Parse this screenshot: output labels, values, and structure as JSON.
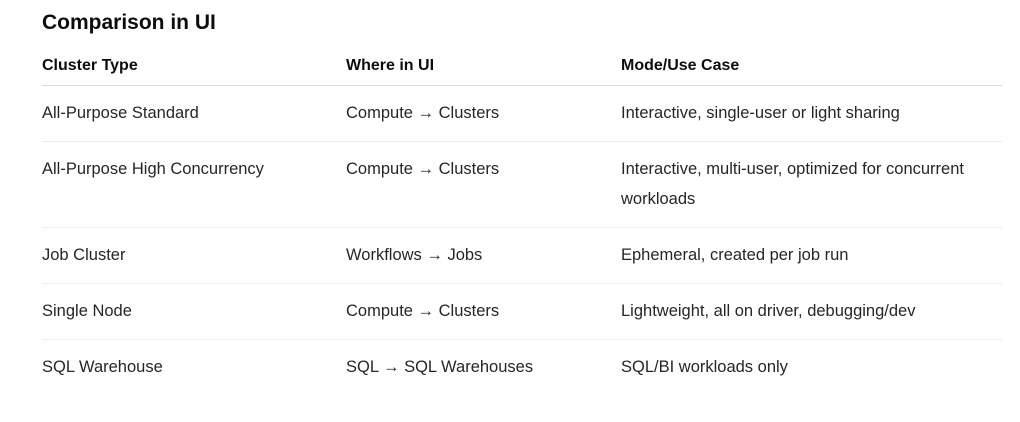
{
  "section": {
    "title": "Comparison in UI"
  },
  "table": {
    "headers": {
      "cluster_type": "Cluster Type",
      "where_in_ui": "Where in UI",
      "mode_use_case": "Mode/Use Case"
    },
    "rows": [
      {
        "cluster_type": "All-Purpose Standard",
        "where_in_ui": "Compute → Clusters",
        "mode_use_case": "Interactive, single-user or light sharing"
      },
      {
        "cluster_type": "All-Purpose High Concurrency",
        "where_in_ui": "Compute → Clusters",
        "mode_use_case": "Interactive, multi-user, optimized for concurrent workloads"
      },
      {
        "cluster_type": "Job Cluster",
        "where_in_ui": "Workflows → Jobs",
        "mode_use_case": "Ephemeral, created per job run"
      },
      {
        "cluster_type": "Single Node",
        "where_in_ui": "Compute → Clusters",
        "mode_use_case": "Lightweight, all on driver, debugging/dev"
      },
      {
        "cluster_type": "SQL Warehouse",
        "where_in_ui": "SQL → SQL Warehouses",
        "mode_use_case": "SQL/BI workloads only"
      }
    ]
  }
}
